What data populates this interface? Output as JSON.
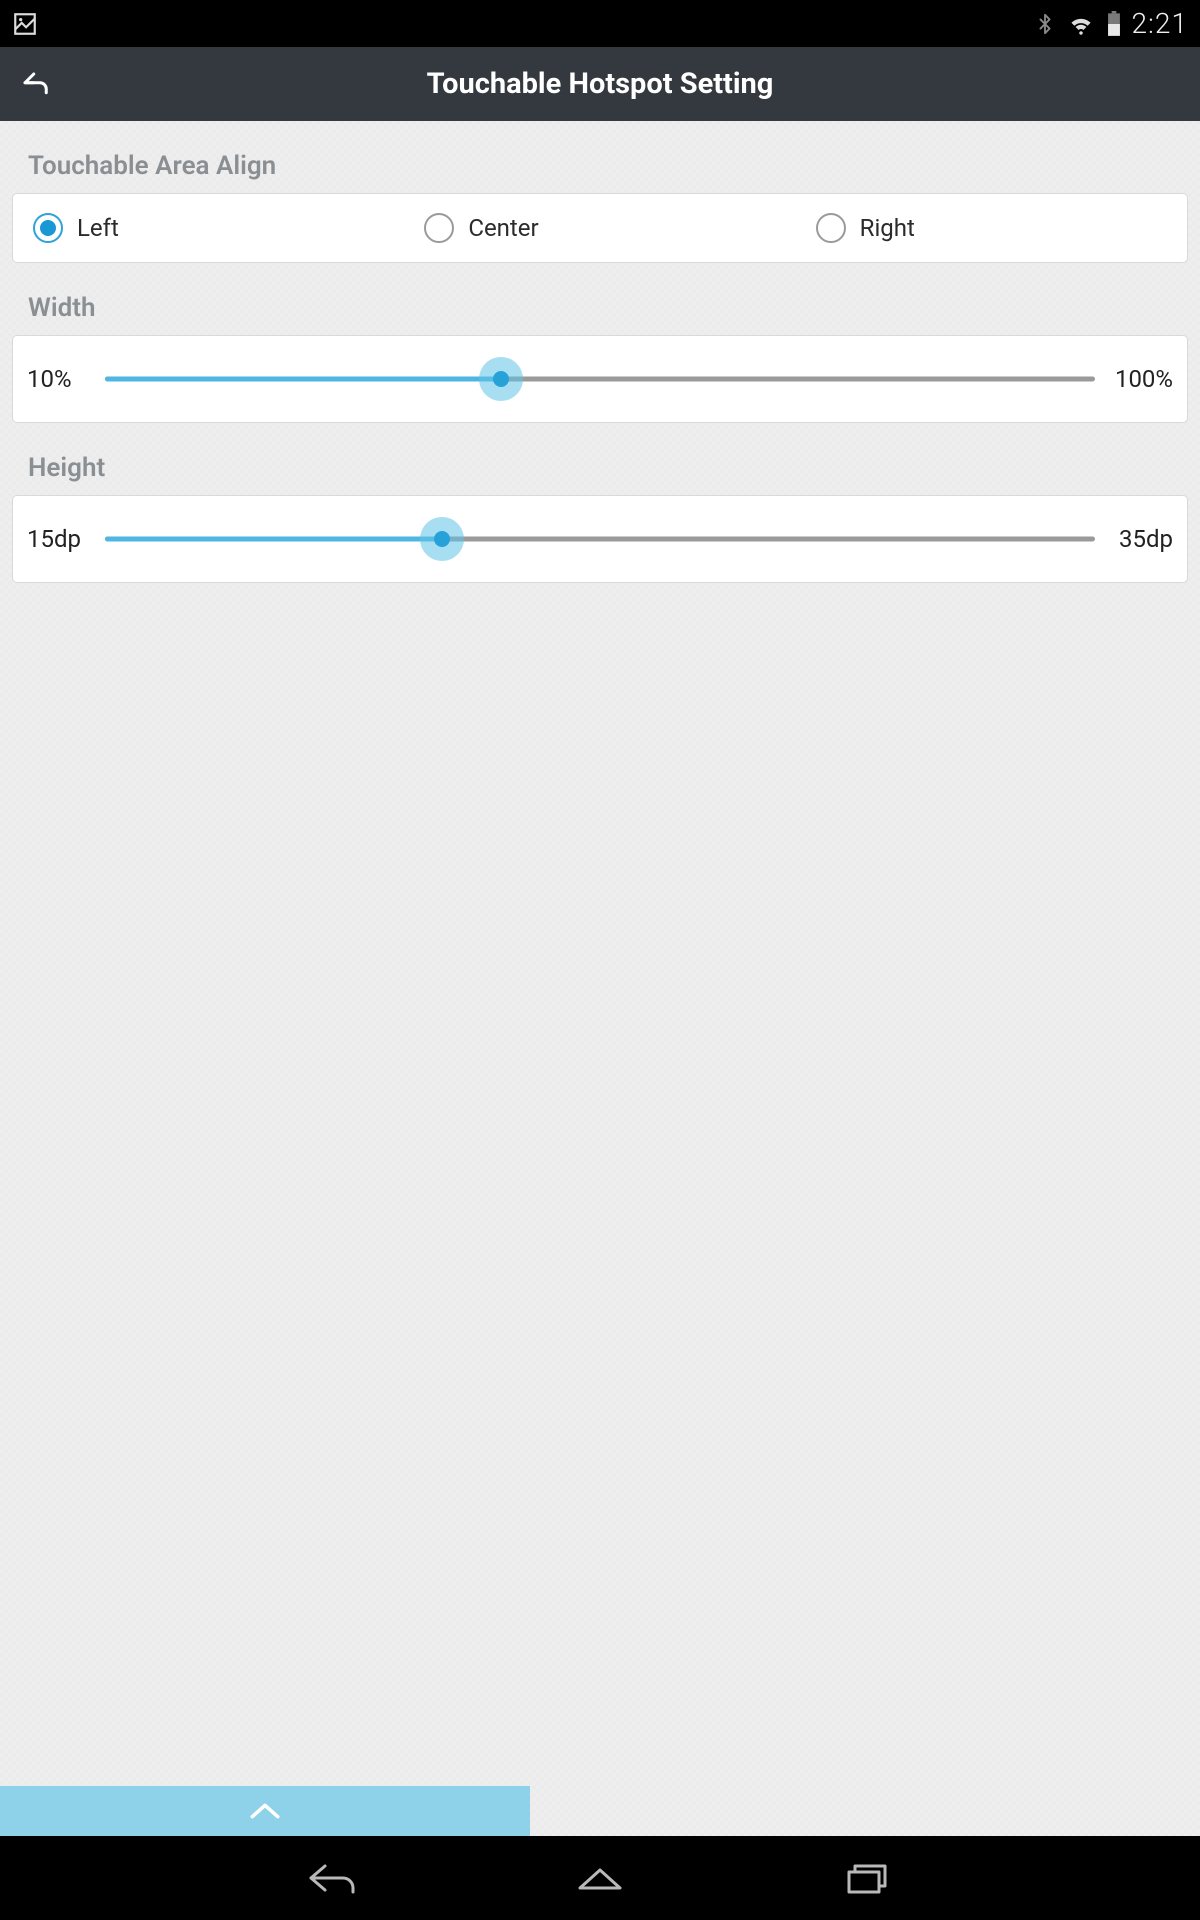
{
  "status": {
    "time": "2:21"
  },
  "header": {
    "title": "Touchable Hotspot Setting"
  },
  "sections": {
    "align": {
      "label": "Touchable Area Align",
      "options": [
        {
          "label": "Left",
          "selected": true
        },
        {
          "label": "Center",
          "selected": false
        },
        {
          "label": "Right",
          "selected": false
        }
      ]
    },
    "width": {
      "label": "Width",
      "min_label": "10%",
      "max_label": "100%",
      "value_percent": 40
    },
    "height": {
      "label": "Height",
      "min_label": "15dp",
      "max_label": "35dp",
      "value_percent": 34
    }
  }
}
